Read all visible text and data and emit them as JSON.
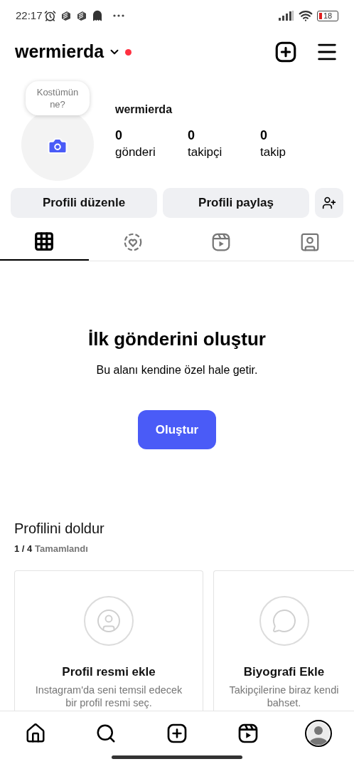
{
  "status_bar": {
    "time": "22:17",
    "battery": "18"
  },
  "header": {
    "username": "wermierda",
    "has_notification": true
  },
  "profile": {
    "bubble": "Kostümün ne?",
    "name": "wermierda",
    "stats": [
      {
        "value": "0",
        "label": "gönderi"
      },
      {
        "value": "0",
        "label": "takipçi"
      },
      {
        "value": "0",
        "label": "takip"
      }
    ]
  },
  "actions": [
    "Profili düzenle",
    "Profili paylaş"
  ],
  "tabs": [
    {
      "kind": "grid",
      "selected": true
    },
    {
      "kind": "highlights",
      "selected": false
    },
    {
      "kind": "reels",
      "selected": false
    },
    {
      "kind": "tagged",
      "selected": false
    }
  ],
  "empty_state": {
    "title": "İlk gönderini oluştur",
    "subtitle": "Bu alanı kendine özel hale getir.",
    "button": "Oluştur"
  },
  "complete_profile": {
    "title": "Profilini doldur",
    "progress": "1 / 4",
    "progress_label": "Tamamlandı",
    "cards": [
      {
        "kind": "photo",
        "title": "Profil resmi ekle",
        "text": "Instagram'da seni temsil edecek bir profil resmi seç."
      },
      {
        "kind": "bio",
        "title": "Biyografi Ekle",
        "text": "Takipçilerine biraz kendi bahset."
      }
    ]
  },
  "bottom_nav": [
    {
      "kind": "home",
      "selected": false
    },
    {
      "kind": "search",
      "selected": false
    },
    {
      "kind": "create",
      "selected": false
    },
    {
      "kind": "reels",
      "selected": false
    },
    {
      "kind": "profile",
      "selected": true
    }
  ]
}
